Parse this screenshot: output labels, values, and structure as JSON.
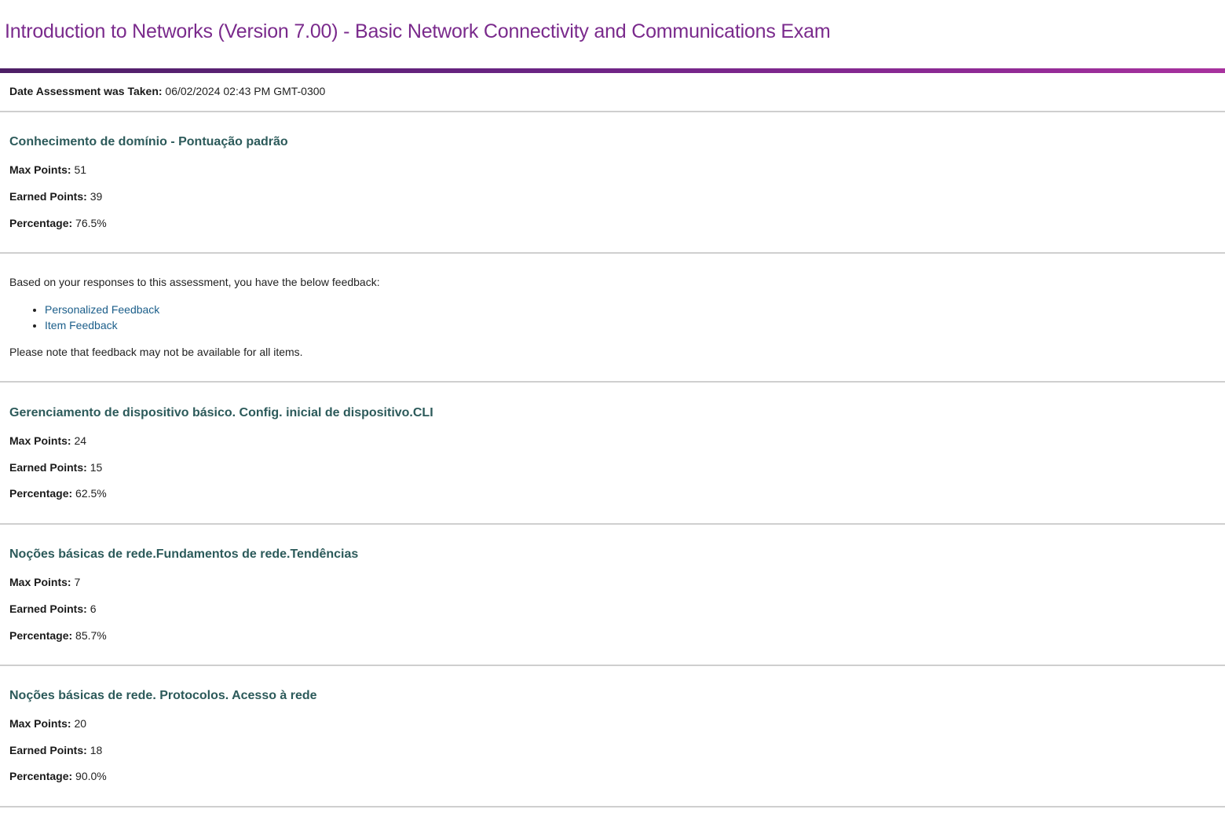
{
  "header": {
    "title": "Introduction to Networks (Version 7.00) - Basic Network Connectivity and Communications Exam",
    "accent_color": "#7a2a8c"
  },
  "assessment": {
    "date_label": "Date Assessment was Taken:",
    "date_value": "06/02/2024 02:43 PM GMT-0300"
  },
  "labels": {
    "max_points": "Max Points:",
    "earned_points": "Earned Points:",
    "percentage": "Percentage:"
  },
  "scores": [
    {
      "title": "Conhecimento de domínio - Pontuação padrão",
      "max_points": "51",
      "earned_points": "39",
      "percentage": "76.5%"
    },
    {
      "title": "Gerenciamento de dispositivo básico. Config. inicial de dispositivo.CLI",
      "max_points": "24",
      "earned_points": "15",
      "percentage": "62.5%"
    },
    {
      "title": "Noções básicas de rede.Fundamentos de rede.Tendências",
      "max_points": "7",
      "earned_points": "6",
      "percentage": "85.7%"
    },
    {
      "title": "Noções básicas de rede. Protocolos. Acesso à rede",
      "max_points": "20",
      "earned_points": "18",
      "percentage": "90.0%"
    }
  ],
  "feedback": {
    "intro": "Based on your responses to this assessment, you have the below feedback:",
    "links": [
      "Personalized Feedback",
      "Item Feedback"
    ],
    "note": "Please note that feedback may not be available for all items."
  }
}
